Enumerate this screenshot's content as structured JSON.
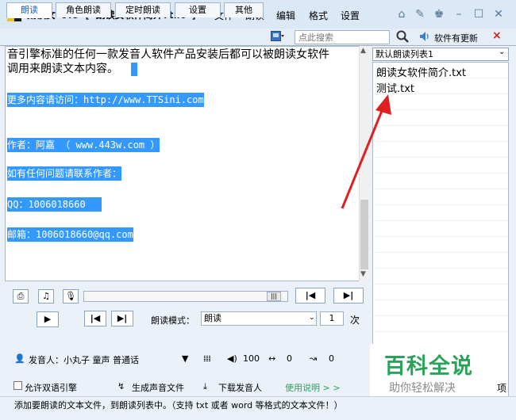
{
  "window": {
    "title": "朗读女 8.5 [ 朗读女软件简介.txt ]",
    "menus": [
      "文件",
      "朗读",
      "编辑",
      "格式",
      "设置"
    ],
    "controls": [
      "home-icon",
      "pin-icon",
      "skin-icon",
      "minimize-icon",
      "maximize-icon",
      "close-icon"
    ]
  },
  "tabs": [
    "朗读",
    "角色朗读",
    "定时朗读",
    "设置",
    "其他"
  ],
  "toolbar": {
    "search_placeholder": "点此搜索",
    "update_label": "软件有更新",
    "close_symbol": "×"
  },
  "editor": {
    "line1": "音引擎标准的任何一款发音人软件产品安装后都可以被朗读女软件",
    "line2": "调用来朗读文本内容。",
    "line3": "更多内容请访问：http://www.TTSini.com",
    "line4": "作者：阿嘉  （ www.443w.com ）",
    "line5": "如有任何问题请联系作者：",
    "line6": "QQ：1006018660",
    "line7": "邮箱：1006018660@qq.com"
  },
  "playlist": {
    "selected": "默认朗读列表1",
    "items": [
      "朗读女软件简介.txt",
      "测试.txt"
    ]
  },
  "player": {
    "mode_label": "朗读模式：",
    "mode_value": "朗读",
    "repeat_count": "1",
    "repeat_unit": "次"
  },
  "voice": {
    "speaker": "发音人：小丸子 童声 普通话",
    "volume": "100",
    "speed": "0",
    "pitch": "0"
  },
  "bottom": {
    "dual_engine": "允许双语引擎",
    "generate_audio": "生成声音文件",
    "download_voice": "下载发音人",
    "help": "使用说明 > >",
    "clipped": "项"
  },
  "watermark": {
    "title": "百科全说",
    "subtitle": "助你轻松解决"
  },
  "status": {
    "text": "添加要朗读的文本文件，到朗读列表中。（支持 txt 或者 word 等格式的文本文件！）"
  },
  "colors": {
    "selection": "#3399ff",
    "accent_blue": "#1d5fbf",
    "watermark_green": "#2aa35a",
    "annotation_red": "#e02020"
  }
}
